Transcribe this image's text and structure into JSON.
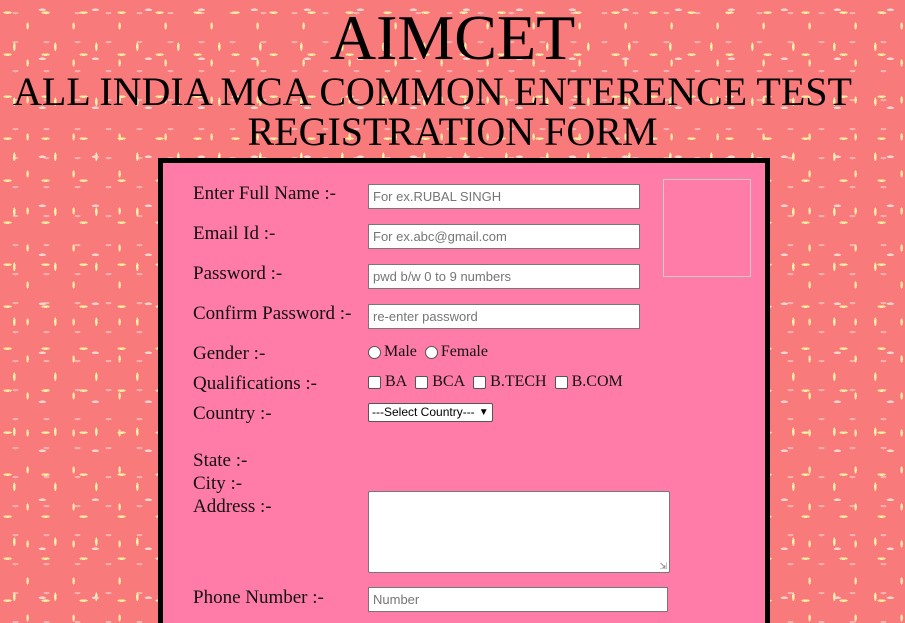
{
  "header": {
    "title": "AIMCET",
    "subtitle": "ALL INDIA MCA COMMON ENTERENCE TEST",
    "form_title": "REGISTRATION FORM"
  },
  "form": {
    "full_name": {
      "label": "Enter Full Name :-",
      "placeholder": "For ex.RUBAL SINGH"
    },
    "email": {
      "label": "Email Id :-",
      "placeholder": "For ex.abc@gmail.com"
    },
    "password": {
      "label": "Password :-",
      "placeholder": "pwd b/w 0 to 9 numbers"
    },
    "confirm_password": {
      "label": "Confirm Password :-",
      "placeholder": "re-enter password"
    },
    "gender": {
      "label": "Gender :-",
      "options": [
        "Male",
        "Female"
      ]
    },
    "qualifications": {
      "label": "Qualifications :-",
      "options": [
        "BA",
        "BCA",
        "B.TECH",
        "B.COM"
      ]
    },
    "country": {
      "label": "Country :-",
      "selected": "---Select Country---"
    },
    "state": {
      "label": "State :-"
    },
    "city": {
      "label": "City :-"
    },
    "address": {
      "label": "Address :-"
    },
    "phone": {
      "label": "Phone Number :-",
      "placeholder": "Number"
    }
  },
  "icons": {
    "select_arrow": "chevron-down-icon",
    "resize": "resize-grip-icon"
  },
  "colors": {
    "page_background": "#f97a7a",
    "form_background": "#ff7ba8",
    "form_border": "#000000"
  }
}
